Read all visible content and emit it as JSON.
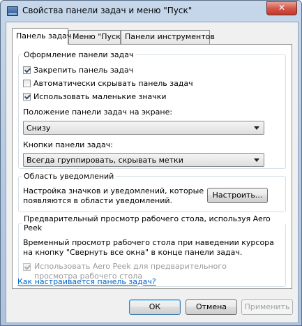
{
  "window": {
    "title": "Свойства панели задач и меню \"Пуск\"",
    "close_glyph": "✕"
  },
  "tabs": [
    {
      "label": "Панель задач",
      "active": true
    },
    {
      "label": "Меню \"Пуск\"",
      "active": false
    },
    {
      "label": "Панели инструментов",
      "active": false
    }
  ],
  "appearance": {
    "legend": "Оформление панели задач",
    "lock_taskbar": {
      "label": "Закрепить панель задач",
      "checked": true
    },
    "auto_hide": {
      "label": "Автоматически скрывать панель задач",
      "checked": false
    },
    "small_icons": {
      "label": "Использовать маленькие значки",
      "checked": true
    },
    "position_label": "Положение панели задач на экране:",
    "position_value": "Снизу",
    "buttons_label": "Кнопки панели задач:",
    "buttons_value": "Всегда группировать, скрывать метки"
  },
  "notification_area": {
    "legend": "Область уведомлений",
    "description": "Настройка значков и уведомлений, которые появляются в области уведомлений.",
    "customize_button": "Настроить..."
  },
  "aero_peek": {
    "legend": "Предварительный просмотр рабочего стола, используя Aero Peek",
    "description": "Временный просмотр рабочего стола при наведении курсора на кнопку \"Свернуть все окна\" в конце панели задач.",
    "use_peek": {
      "label": "Использовать Aero Peek для предварительного просмотра рабочего стола",
      "checked": true,
      "disabled": true
    }
  },
  "help_link": "Как настраивается панель задач?",
  "buttons": {
    "ok": "ОК",
    "cancel": "Отмена",
    "apply": "Применить"
  },
  "colors": {
    "link": "#0066cc",
    "default_button_border": "#3c7fb1",
    "close_button": "#c23a2c"
  }
}
